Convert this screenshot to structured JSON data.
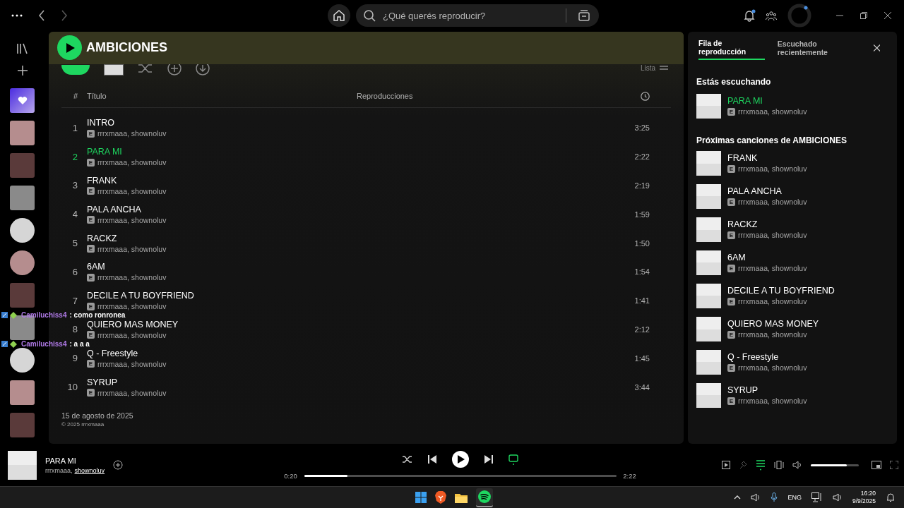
{
  "topbar": {
    "search_placeholder": "¿Qué querés reproducir?",
    "notifications_dot": true
  },
  "sidebar": {
    "items": [
      {
        "kind": "liked"
      },
      {
        "kind": "playlist"
      },
      {
        "kind": "playlist"
      },
      {
        "kind": "playlist"
      },
      {
        "kind": "artist"
      },
      {
        "kind": "artist"
      },
      {
        "kind": "playlist"
      },
      {
        "kind": "playlist"
      },
      {
        "kind": "artist"
      },
      {
        "kind": "playlist"
      },
      {
        "kind": "playlist"
      }
    ]
  },
  "album": {
    "title": "AMBICIONES",
    "view_label": "Lista",
    "columns": [
      "#",
      "Título",
      "Reproducciones"
    ],
    "tracks": [
      {
        "number": "1",
        "title": "INTRO",
        "badge": "E",
        "artists": "rrrxmaaa, shownoluv",
        "duration": "3:25",
        "playing": false
      },
      {
        "number": "2",
        "title": "PARA MI",
        "badge": "E",
        "artists": "rrrxmaaa, shownoluv",
        "duration": "2:22",
        "playing": true
      },
      {
        "number": "3",
        "title": "FRANK",
        "badge": "E",
        "artists": "rrrxmaaa, shownoluv",
        "duration": "2:19",
        "playing": false
      },
      {
        "number": "4",
        "title": "PALA ANCHA",
        "badge": "E",
        "artists": "rrrxmaaa, shownoluv",
        "duration": "1:59",
        "playing": false
      },
      {
        "number": "5",
        "title": "RACKZ",
        "badge": "E",
        "artists": "rrrxmaaa, shownoluv",
        "duration": "1:50",
        "playing": false
      },
      {
        "number": "6",
        "title": "6AM",
        "badge": "E",
        "artists": "rrrxmaaa, shownoluv",
        "duration": "1:54",
        "playing": false
      },
      {
        "number": "7",
        "title": "DECILE A TU BOYFRIEND",
        "badge": "E",
        "artists": "rrrxmaaa, shownoluv",
        "duration": "1:41",
        "playing": false
      },
      {
        "number": "8",
        "title": "QUIERO MAS MONEY",
        "badge": "E",
        "artists": "rrrxmaaa, shownoluv",
        "duration": "2:12",
        "playing": false
      },
      {
        "number": "9",
        "title": "Q - Freestyle",
        "badge": "E",
        "artists": "rrrxmaaa, shownoluv",
        "duration": "1:45",
        "playing": false
      },
      {
        "number": "10",
        "title": "SYRUP",
        "badge": "E",
        "artists": "rrrxmaaa, shownoluv",
        "duration": "3:44",
        "playing": false
      }
    ],
    "release_date": "15 de agosto de 2025",
    "copyright": "© 2025 rrrxmaaa"
  },
  "chat_overlay": [
    {
      "user": "Camiluchiss4",
      "message": ": como ronronea"
    },
    {
      "user": "Camiluchiss4",
      "message": ": a a a"
    }
  ],
  "queue_panel": {
    "tabs": [
      {
        "label": "Fila de reproducción",
        "selected": true
      },
      {
        "label": "Escuchado recientemente",
        "selected": false
      }
    ],
    "now_heading": "Estás escuchando",
    "now": {
      "title": "PARA MI",
      "badge": "E",
      "artists": "rrrxmaaa, shownoluv"
    },
    "next_heading": "Próximas canciones de AMBICIONES",
    "next": [
      {
        "title": "FRANK",
        "badge": "E",
        "artists": "rrrxmaaa, shownoluv"
      },
      {
        "title": "PALA ANCHA",
        "badge": "E",
        "artists": "rrrxmaaa, shownoluv"
      },
      {
        "title": "RACKZ",
        "badge": "E",
        "artists": "rrrxmaaa, shownoluv"
      },
      {
        "title": "6AM",
        "badge": "E",
        "artists": "rrrxmaaa, shownoluv"
      },
      {
        "title": "DECILE A TU BOYFRIEND",
        "badge": "E",
        "artists": "rrrxmaaa, shownoluv"
      },
      {
        "title": "QUIERO MAS MONEY",
        "badge": "E",
        "artists": "rrrxmaaa, shownoluv"
      },
      {
        "title": "Q - Freestyle",
        "badge": "E",
        "artists": "rrrxmaaa, shownoluv"
      },
      {
        "title": "SYRUP",
        "badge": "E",
        "artists": "rrrxmaaa, shownoluv"
      }
    ]
  },
  "player": {
    "title": "PARA MI",
    "artist_1": "rrrxmaaa,",
    "artist_2": "shownoluv",
    "elapsed": "0:20",
    "total": "2:22",
    "level": 0.14,
    "repeat_on": true,
    "queue_on": true,
    "volume": {
      "level": 0.75
    }
  },
  "taskbar": {
    "language": "ENG",
    "time": "16:20",
    "date": "9/9/2025"
  }
}
